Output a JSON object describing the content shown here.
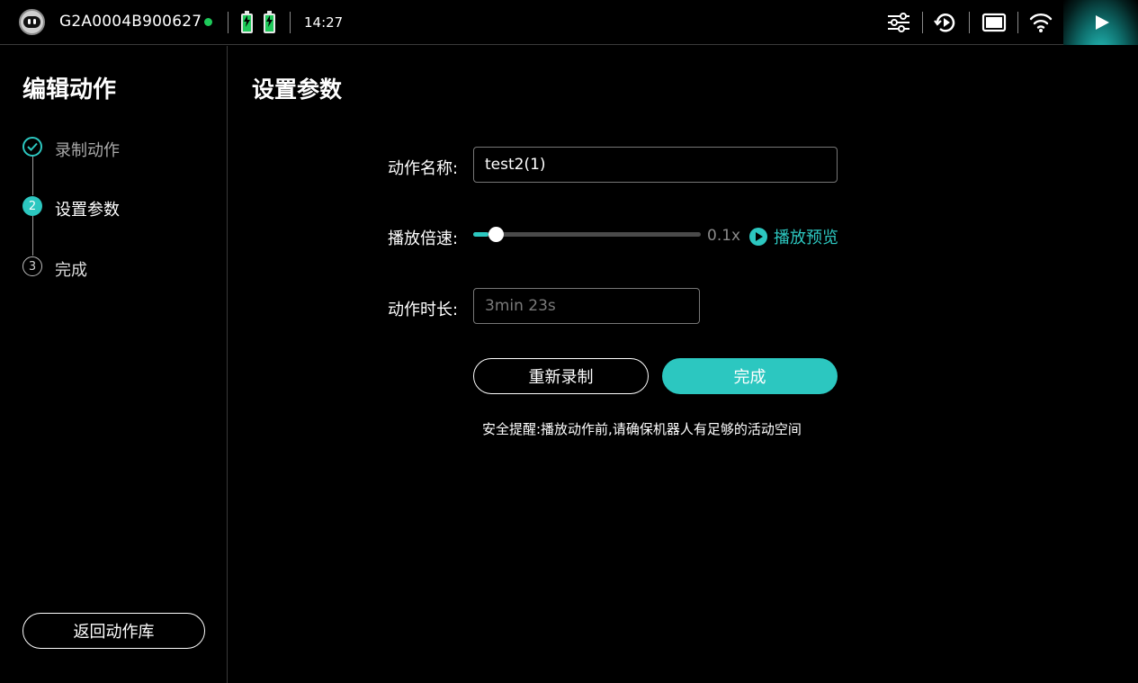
{
  "statusbar": {
    "device_id": "G2A0004B900627",
    "online_color": "#1ec95a",
    "time": "14:27",
    "icons": [
      "robot-avatar-icon",
      "battery-charging-icon",
      "battery-charging-icon",
      "sliders-icon",
      "rotate-play-icon",
      "screen-icon",
      "wifi-icon",
      "play-icon"
    ]
  },
  "sidebar": {
    "title": "编辑动作",
    "steps": [
      {
        "marker": "",
        "label": "录制动作",
        "state": "done"
      },
      {
        "marker": "2",
        "label": "设置参数",
        "state": "active"
      },
      {
        "marker": "3",
        "label": "完成",
        "state": "pending"
      }
    ],
    "back_label": "返回动作库"
  },
  "main": {
    "title": "设置参数",
    "name_label": "动作名称:",
    "name_value": "test2(1)",
    "speed_label": "播放倍速:",
    "speed_value_text": "0.1x",
    "speed_fraction": 0.05,
    "preview_label": "播放预览",
    "duration_label": "动作时长:",
    "duration_value": "3min 23s",
    "rerecord_label": "重新录制",
    "finish_label": "完成",
    "safety_note": "安全提醒:播放动作前,请确保机器人有足够的活动空间"
  },
  "colors": {
    "accent": "#2cc7c0",
    "background": "#000000"
  }
}
